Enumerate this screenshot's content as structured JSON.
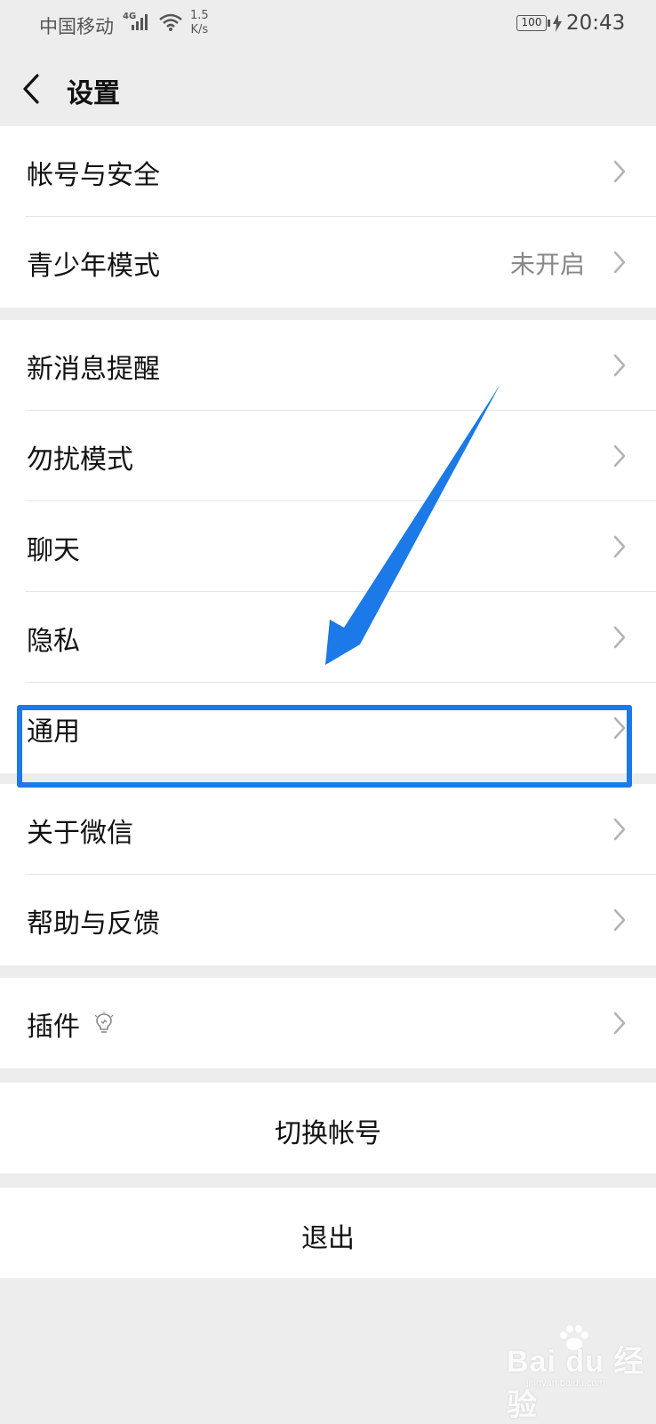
{
  "status_bar": {
    "carrier": "中国移动",
    "network": "4G",
    "speed_value": "1.5",
    "speed_unit": "K/s",
    "battery": "100",
    "time": "20:43"
  },
  "nav": {
    "title": "设置",
    "back_icon": "chevron-left-icon"
  },
  "groups": [
    {
      "items": [
        {
          "label": "帐号与安全",
          "value": ""
        },
        {
          "label": "青少年模式",
          "value": "未开启"
        }
      ]
    },
    {
      "items": [
        {
          "label": "新消息提醒",
          "value": ""
        },
        {
          "label": "勿扰模式",
          "value": ""
        },
        {
          "label": "聊天",
          "value": ""
        },
        {
          "label": "隐私",
          "value": ""
        },
        {
          "label": "通用",
          "value": "",
          "highlighted": true
        }
      ]
    },
    {
      "items": [
        {
          "label": "关于微信",
          "value": ""
        },
        {
          "label": "帮助与反馈",
          "value": ""
        }
      ]
    },
    {
      "items": [
        {
          "label": "插件",
          "value": "",
          "icon": "lightbulb-icon"
        }
      ]
    }
  ],
  "actions": {
    "switch_account": "切换帐号",
    "logout": "退出"
  },
  "annotation": {
    "highlight_color": "#1b79e8",
    "arrow_color": "#1b79e8"
  },
  "watermark": {
    "brand": "Bai du 经验",
    "url": "jingyan.baidu.com"
  },
  "colors": {
    "background": "#ededed",
    "card": "#ffffff",
    "secondary_text": "#888888",
    "chevron": "#b2b2b2"
  }
}
